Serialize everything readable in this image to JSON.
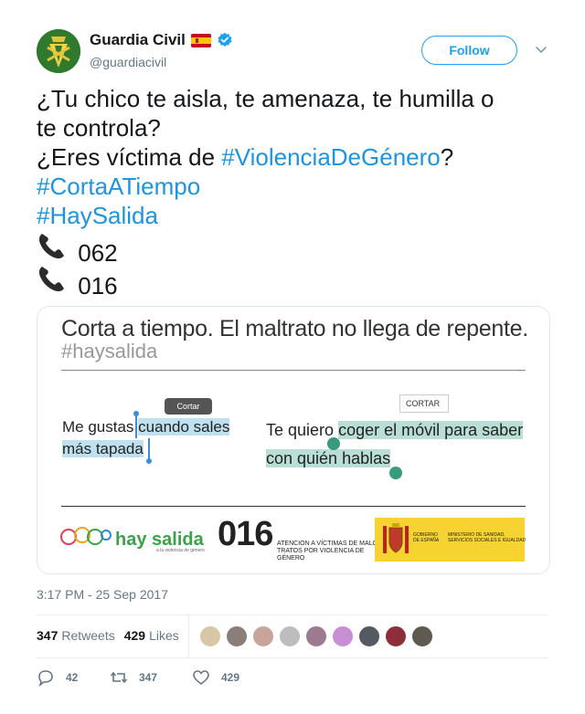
{
  "user": {
    "display_name": "Guardia Civil",
    "handle": "@guardiacivil",
    "follow_label": "Follow",
    "verified_icon": "verified-badge-icon",
    "flag_icon": "spain-flag-icon"
  },
  "tweet": {
    "lines": [
      "¿Tu chico te aisla, te amenaza, te humilla o",
      "te controla?"
    ],
    "line3_prefix": "¿Eres víctima de ",
    "line3_hashtag": "#ViolenciaDeGénero",
    "line3_suffix": "?",
    "hashtag2": "#CortaATiempo",
    "hashtag3": "#HaySalida",
    "phone1": "062",
    "phone2": "016",
    "phone_icon": "telephone-receiver-icon"
  },
  "media": {
    "title": "Corta a tiempo. El maltrato no llega de repente.",
    "hashtag": "#haysalida",
    "example1_prefix": "Me gustas ",
    "example1_hl1": "cuando sales",
    "example1_hl2": "más tapada",
    "tooltip_label": "Cortar",
    "example2_prefix": "Te quiero ",
    "example2_hl1": "coger el móvil para saber",
    "example2_hl2": "con quién hablas",
    "cortar_label": "CORTAR",
    "hay_salida": "hay salida",
    "hay_salida_sub": "a la violencia de género",
    "number_016": "016",
    "number_016_desc": "ATENCIÓN A VÍCTIMAS DE MALOS TRATOS POR VIOLENCIA DE GÉNERO",
    "gov_text1": "GOBIERNO DE ESPAÑA",
    "gov_text2": "MINISTERIO DE SANIDAD, SERVICIOS SOCIALES E IGUALDAD"
  },
  "timestamp": "3:17 PM - 25 Sep 2017",
  "stats": {
    "retweets_count": "347",
    "retweets_label": "Retweets",
    "likes_count": "429",
    "likes_label": "Likes"
  },
  "liker_colors": [
    "#d8c7a4",
    "#8a7f78",
    "#c9a49a",
    "#bdbdbd",
    "#9d7a8f",
    "#c98fd4",
    "#555a60",
    "#8c2f3a",
    "#5e5a52"
  ],
  "actions": {
    "reply_count": "42",
    "retweet_count": "347",
    "like_count": "429"
  }
}
